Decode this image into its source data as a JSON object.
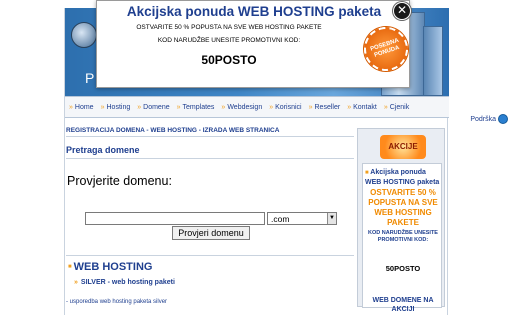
{
  "header": {
    "tagline_fragment": "P"
  },
  "nav": {
    "items": [
      "Home",
      "Hosting",
      "Domene",
      "Templates",
      "Webdesign",
      "Korisnici",
      "Reseller",
      "Kontakt",
      "Cjenik"
    ],
    "support_label": "Podrška"
  },
  "main": {
    "breadcrumb": "REGISTRACIJA DOMENA - WEB HOSTING - IZRADA WEB STRANICA",
    "search_title": "Pretraga domene",
    "check_label": "Provjerite domenu:",
    "domain_input_value": "",
    "tld_selected": ".com",
    "search_button": "Provjeri domenu",
    "web_hosting_title": "WEB HOSTING",
    "silver_link": "SILVER - web hosting paketi",
    "compare_link": "- usporedba web hosting paketa silver"
  },
  "sidebar": {
    "akcije_label": "AKCIJE",
    "title": "Akcijska ponuda WEB HOSTING paketa",
    "offer": "OSTVARITE 50 % POPUSTA NA SVE WEB HOSTING PAKETE",
    "note": "KOD NARUDŽBE UNESITE PROMOTIVNI KOD:",
    "code": "50POSTO",
    "web_domene": "WEB DOMENE NA AKCIJI"
  },
  "popup": {
    "title": "Akcijska ponuda WEB HOSTING paketa",
    "offer": "OSTVARITE 50 % POPUSTA NA SVE WEB HOSTING PAKETE",
    "note": "KOD NARUDŽBE UNESITE PROMOTIVNI KOD:",
    "code": "50POSTO",
    "seal_text": "POSEBNA PONUDA"
  },
  "colors": {
    "link_blue": "#1f3f8f",
    "accent_orange": "#f08a00"
  }
}
